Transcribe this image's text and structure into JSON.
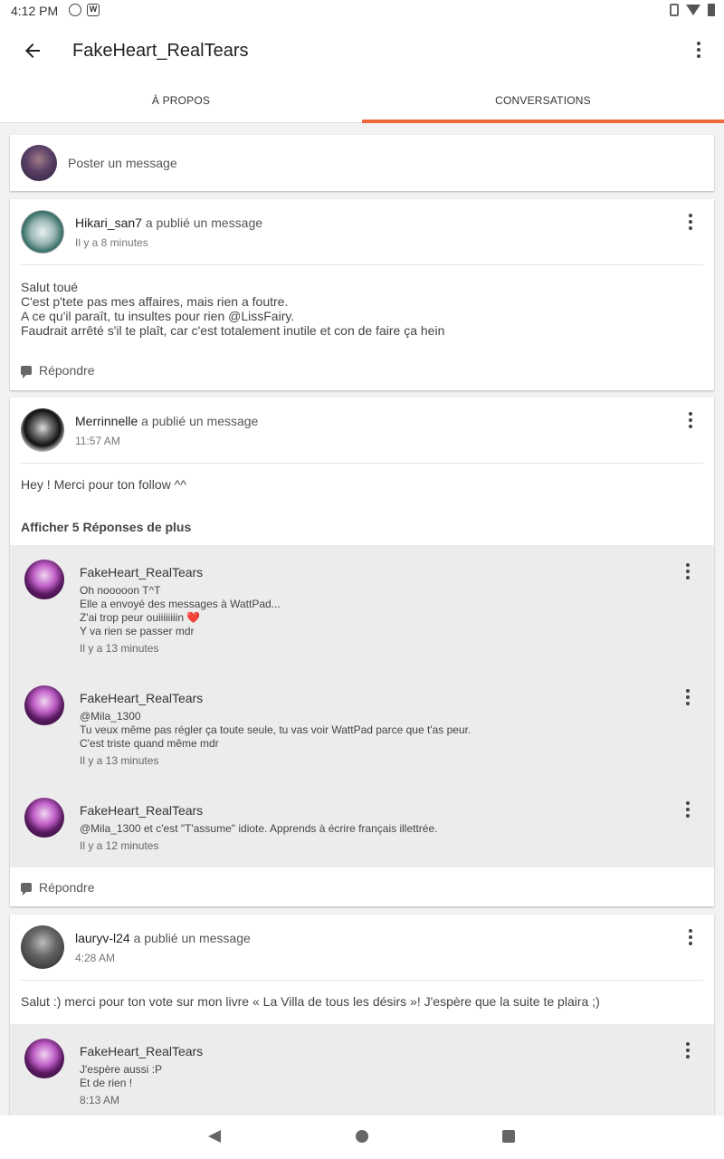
{
  "status": {
    "time": "4:12 PM",
    "icon1": "circle-icon",
    "icon2": "w-icon",
    "icon2_label": "W"
  },
  "appbar": {
    "title": "FakeHeart_RealTears"
  },
  "tabs": [
    {
      "label": "À PROPOS"
    },
    {
      "label": "CONVERSATIONS"
    }
  ],
  "accent": "#ee6a3a",
  "composer": {
    "placeholder": "Poster un message"
  },
  "posts": [
    {
      "author": "Hikari_san7",
      "action": " a publié un message",
      "time": "Il y a 8 minutes",
      "text": "Salut toué\nC'est p'tete pas mes affaires, mais rien a foutre.\nA ce qu'il paraît, tu insultes pour rien @LissFairy.\nFaudrait arrêté s'il te plaît, car c'est totalement inutile et con de faire ça hein",
      "reply_label": "Répondre"
    },
    {
      "author": "Merrinnelle",
      "action": " a publié un message",
      "time": "11:57 AM",
      "text": "Hey ! Merci pour ton follow ^^",
      "show_more": "Afficher 5 Réponses de plus",
      "replies": [
        {
          "author": "FakeHeart_RealTears",
          "text": "Oh nooooon T^T\nElle a envoyé des messages à WattPad...\nZ'ai trop peur ouiiiiiiiin",
          "text_tail": "Y va rien se passer mdr",
          "heart": "❤️",
          "time": "Il y a 13 minutes"
        },
        {
          "author": "FakeHeart_RealTears",
          "text": "@Mila_1300\nTu veux même pas régler ça toute seule, tu vas voir WattPad parce que t'as peur.\nC'est triste quand même mdr",
          "time": "Il y a 13 minutes"
        },
        {
          "author": "FakeHeart_RealTears",
          "text": "@Mila_1300 et c'est \"T'assume\" idiote. Apprends à écrire français illettrée.",
          "time": "Il y a 12 minutes"
        }
      ],
      "reply_label": "Répondre"
    },
    {
      "author": "lauryv-l24",
      "action": " a publié un message",
      "time": "4:28 AM",
      "text": "Salut :) merci pour ton vote sur mon livre « La Villa de tous les désirs »! J'espère que la suite te plaira ;)",
      "replies": [
        {
          "author": "FakeHeart_RealTears",
          "text": "J'espère aussi :P\nEt de rien !",
          "time": "8:13 AM"
        }
      ]
    }
  ]
}
